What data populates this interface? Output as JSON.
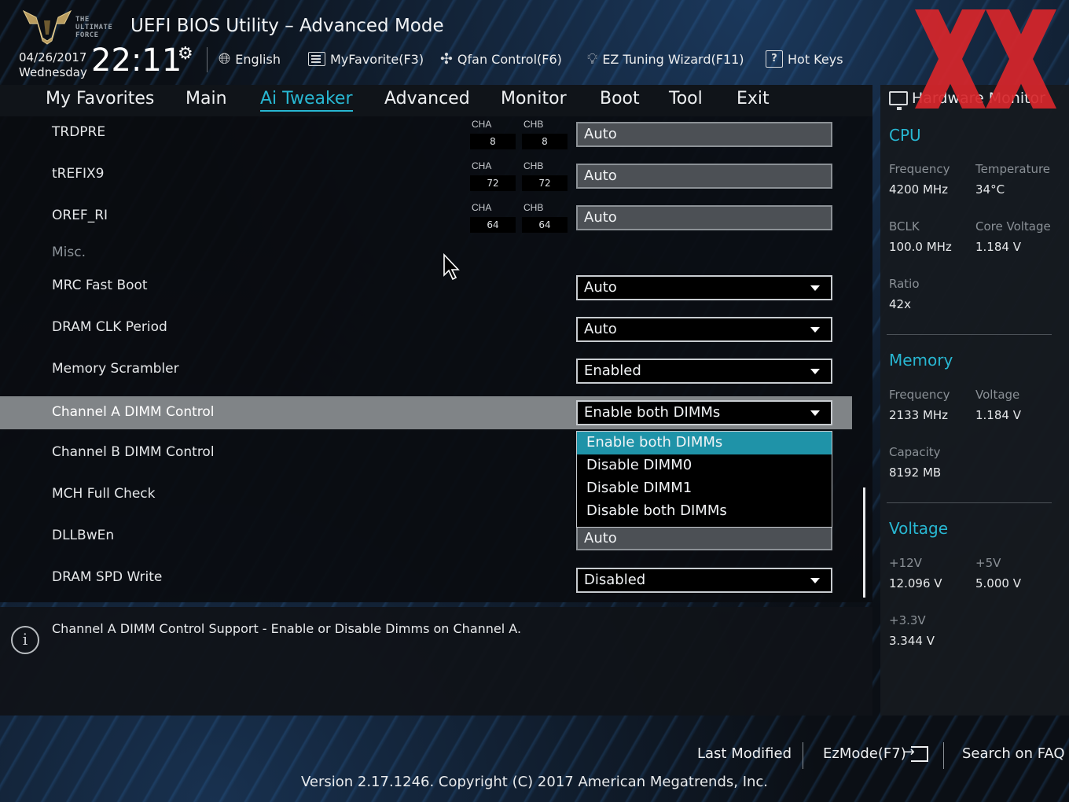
{
  "header": {
    "logo_text": "THE\nULTIMATE\nFORCE",
    "title": "UEFI BIOS Utility – Advanced Mode",
    "date": "04/26/2017",
    "weekday": "Wednesday",
    "time": "22:11",
    "toolbar": {
      "language": "English",
      "my_favorite": "MyFavorite(F3)",
      "qfan": "Qfan Control(F6)",
      "ez_tuning": "EZ Tuning Wizard(F11)",
      "hot_keys": "Hot Keys"
    }
  },
  "nav": {
    "tabs": [
      "My Favorites",
      "Main",
      "Ai Tweaker",
      "Advanced",
      "Monitor",
      "Boot",
      "Tool",
      "Exit"
    ],
    "active": "Ai Tweaker"
  },
  "settings": {
    "trdpre": {
      "label": "TRDPRE",
      "cha_label": "CHA",
      "cha": "8",
      "chb_label": "CHB",
      "chb": "8",
      "value": "Auto"
    },
    "trefix9": {
      "label": "tREFIX9",
      "cha_label": "CHA",
      "cha": "72",
      "chb_label": "CHB",
      "chb": "72",
      "value": "Auto"
    },
    "oref_ri": {
      "label": "OREF_RI",
      "cha_label": "CHA",
      "cha": "64",
      "chb_label": "CHB",
      "chb": "64",
      "value": "Auto"
    },
    "misc_header": "Misc.",
    "mrc_fast_boot": {
      "label": "MRC Fast Boot",
      "value": "Auto"
    },
    "dram_clk_period": {
      "label": "DRAM CLK Period",
      "value": "Auto"
    },
    "memory_scrambler": {
      "label": "Memory Scrambler",
      "value": "Enabled"
    },
    "channel_a_dimm": {
      "label": "Channel A DIMM Control",
      "value": "Enable both DIMMs"
    },
    "channel_b_dimm": {
      "label": "Channel B DIMM Control"
    },
    "mch_full_check": {
      "label": "MCH Full Check"
    },
    "dllbwen": {
      "label": "DLLBwEn",
      "value": "Auto"
    },
    "dram_spd_write": {
      "label": "DRAM SPD Write",
      "value": "Disabled"
    }
  },
  "dropdown": {
    "options": [
      "Enable both DIMMs",
      "Disable DIMM0",
      "Disable DIMM1",
      "Disable both DIMMs"
    ],
    "selected": "Enable both DIMMs"
  },
  "help": {
    "text": "Channel A DIMM Control Support - Enable or Disable Dimms on Channel A."
  },
  "hardware_monitor": {
    "title": "Hardware Monitor",
    "cpu": {
      "header": "CPU",
      "frequency_label": "Frequency",
      "frequency": "4200 MHz",
      "temperature_label": "Temperature",
      "temperature": "34°C",
      "bclk_label": "BCLK",
      "bclk": "100.0 MHz",
      "core_voltage_label": "Core Voltage",
      "core_voltage": "1.184 V",
      "ratio_label": "Ratio",
      "ratio": "42x"
    },
    "memory": {
      "header": "Memory",
      "frequency_label": "Frequency",
      "frequency": "2133 MHz",
      "voltage_label": "Voltage",
      "voltage": "1.184 V",
      "capacity_label": "Capacity",
      "capacity": "8192 MB"
    },
    "voltage": {
      "header": "Voltage",
      "v12_label": "+12V",
      "v12": "12.096 V",
      "v5_label": "+5V",
      "v5": "5.000 V",
      "v33_label": "+3.3V",
      "v33": "3.344 V"
    }
  },
  "footer": {
    "last_modified": "Last Modified",
    "ez_mode": "EzMode(F7)",
    "search_faq": "Search on FAQ",
    "version": "Version 2.17.1246. Copyright (C) 2017 American Megatrends, Inc."
  },
  "colors": {
    "accent": "#28b7d2",
    "dropdown_selected": "#1f93a8",
    "row_highlight": "#808487",
    "watermark_red": "#d8262b"
  }
}
